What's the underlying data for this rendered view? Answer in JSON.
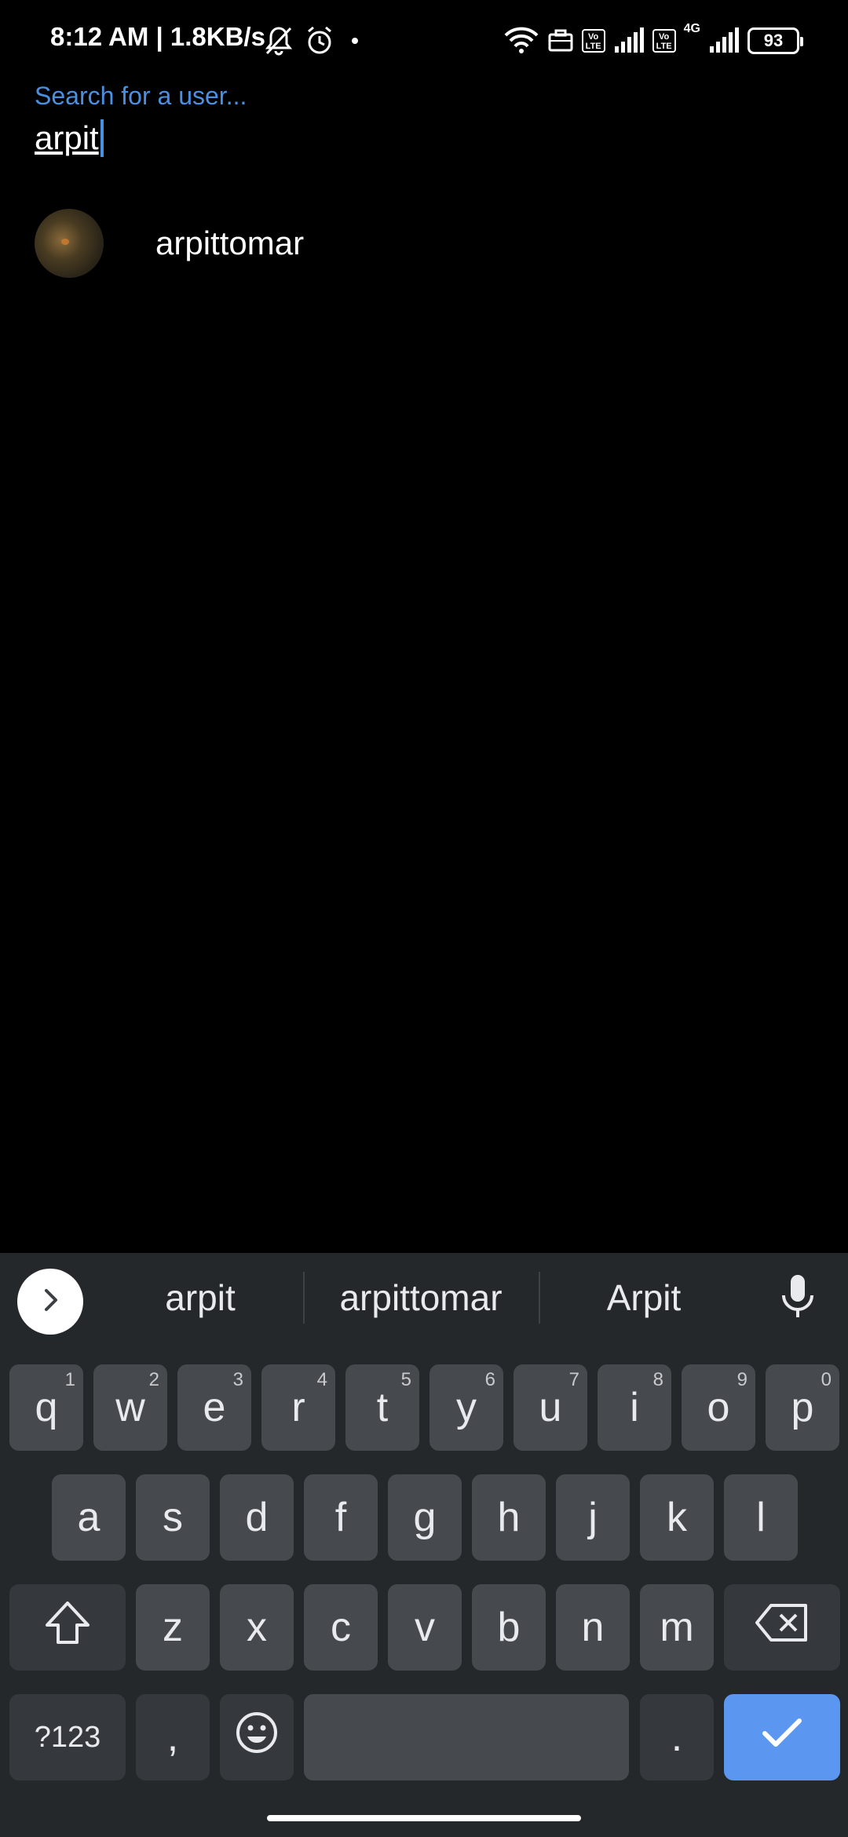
{
  "status_bar": {
    "time_text": "8:12 AM | 1.8KB/s",
    "battery": "93",
    "volte1": "Vo LTE",
    "volte2": "Vo LTE",
    "network": "4G"
  },
  "search": {
    "placeholder": "Search for a user...",
    "value": "arpit"
  },
  "results": [
    {
      "username": "arpittomar"
    }
  ],
  "keyboard": {
    "suggestions": [
      "arpit",
      "arpittomar",
      "Arpit"
    ],
    "row1": [
      {
        "label": "q",
        "hint": "1"
      },
      {
        "label": "w",
        "hint": "2"
      },
      {
        "label": "e",
        "hint": "3"
      },
      {
        "label": "r",
        "hint": "4"
      },
      {
        "label": "t",
        "hint": "5"
      },
      {
        "label": "y",
        "hint": "6"
      },
      {
        "label": "u",
        "hint": "7"
      },
      {
        "label": "i",
        "hint": "8"
      },
      {
        "label": "o",
        "hint": "9"
      },
      {
        "label": "p",
        "hint": "0"
      }
    ],
    "row2": [
      "a",
      "s",
      "d",
      "f",
      "g",
      "h",
      "j",
      "k",
      "l"
    ],
    "row3": [
      "z",
      "x",
      "c",
      "v",
      "b",
      "n",
      "m"
    ],
    "symbols_label": "?123",
    "comma_label": ",",
    "period_label": ".",
    "accent_color": "#5b96f0"
  }
}
